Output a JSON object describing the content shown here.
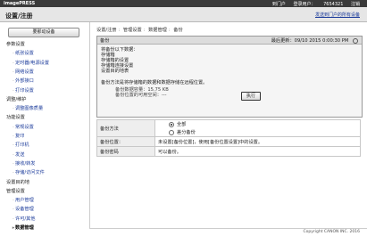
{
  "top": {
    "logo": "imagePRESS",
    "links": [
      "到门户",
      "登录用户：",
      "7654321",
      "注销"
    ]
  },
  "header": {
    "title": "设置/注册",
    "link": "发送到门户的所有设备"
  },
  "sidebar": {
    "register_button": "要那动设备",
    "items": [
      {
        "type": "group",
        "label": "参数设置"
      },
      {
        "type": "link",
        "label": "纸张设置"
      },
      {
        "type": "link",
        "label": "定时器/电源设置"
      },
      {
        "type": "link",
        "label": "网络设置"
      },
      {
        "type": "link",
        "label": "外部接口"
      },
      {
        "type": "link",
        "label": "打印设置"
      },
      {
        "type": "group",
        "label": "调整/维护"
      },
      {
        "type": "link",
        "label": "调整图像质量"
      },
      {
        "type": "group",
        "label": "功能设置"
      },
      {
        "type": "link",
        "label": "常规设置"
      },
      {
        "type": "link",
        "label": "复印"
      },
      {
        "type": "link",
        "label": "打印机"
      },
      {
        "type": "link",
        "label": "发送"
      },
      {
        "type": "link",
        "label": "接收/转发"
      },
      {
        "type": "link",
        "label": "存储/访问文件"
      },
      {
        "type": "group",
        "label": "设置目的地"
      },
      {
        "type": "group",
        "label": "管理设置"
      },
      {
        "type": "link",
        "label": "用户管理"
      },
      {
        "type": "link",
        "label": "设备管理"
      },
      {
        "type": "link",
        "label": "许可/其他"
      },
      {
        "type": "link",
        "label": "数据管理",
        "active": true
      }
    ]
  },
  "breadcrumb": [
    "设置/注册",
    "管理设置",
    "数据管理",
    "备份"
  ],
  "panel": {
    "title": "备份",
    "timestamp": "最后更新：09/10 2015 0:00:30 PM",
    "lines": [
      "将备份以下数据：",
      "存储箱",
      "存储箱的设置",
      "存储箱连接设置",
      "设置目的地表"
    ],
    "note": "备份方法是将存储箱的数据和数据存储在远程位置。",
    "stats": [
      "备份数据容量：15.75 KB",
      "备份位置的可用空间：---"
    ],
    "run_button": "执行"
  },
  "settings": {
    "method_label": "备份方法",
    "method_options": [
      "全部",
      "差分备份"
    ],
    "location_label": "备份位置：",
    "location_value": "未设置[备份位置]，使用[备份位置设置]中的设置。",
    "password_label": "备份密码",
    "password_value": "可以备份。"
  },
  "footer": {
    "copyright": "Copyright CANON INC. 2016"
  }
}
